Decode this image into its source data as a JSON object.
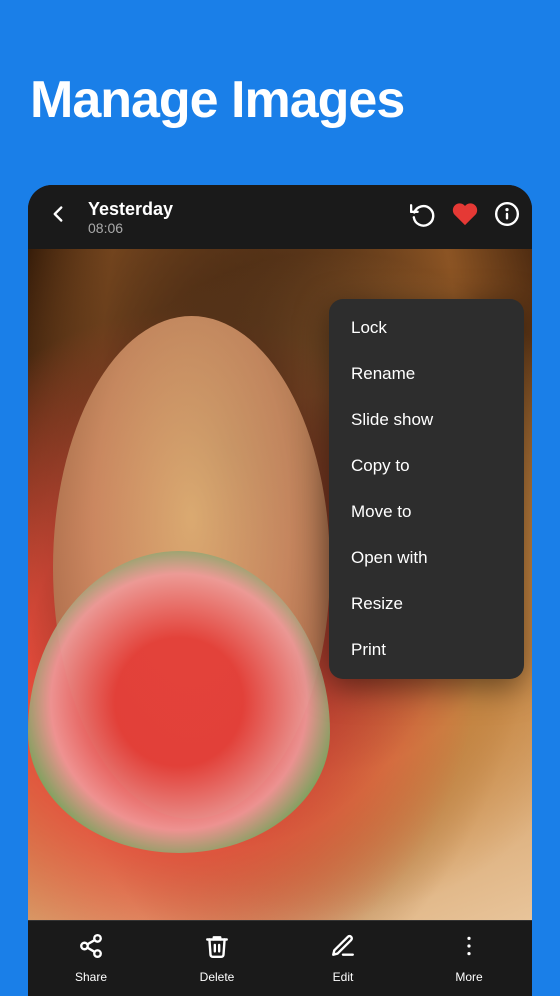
{
  "header": {
    "title": "Manage Images"
  },
  "topbar": {
    "photo_title": "Yesterday",
    "photo_time": "08:06",
    "back_label": "‹",
    "rotate_icon": "rotate",
    "heart_icon": "heart",
    "info_icon": "info"
  },
  "context_menu": {
    "items": [
      {
        "id": "lock",
        "label": "Lock"
      },
      {
        "id": "rename",
        "label": "Rename"
      },
      {
        "id": "slideshow",
        "label": "Slide show"
      },
      {
        "id": "copy-to",
        "label": "Copy to"
      },
      {
        "id": "move-to",
        "label": "Move to"
      },
      {
        "id": "open-with",
        "label": "Open with"
      },
      {
        "id": "resize",
        "label": "Resize"
      },
      {
        "id": "print",
        "label": "Print"
      }
    ]
  },
  "toolbar": {
    "items": [
      {
        "id": "share",
        "label": "Share"
      },
      {
        "id": "delete",
        "label": "Delete"
      },
      {
        "id": "edit",
        "label": "Edit"
      },
      {
        "id": "more",
        "label": "More"
      }
    ]
  }
}
